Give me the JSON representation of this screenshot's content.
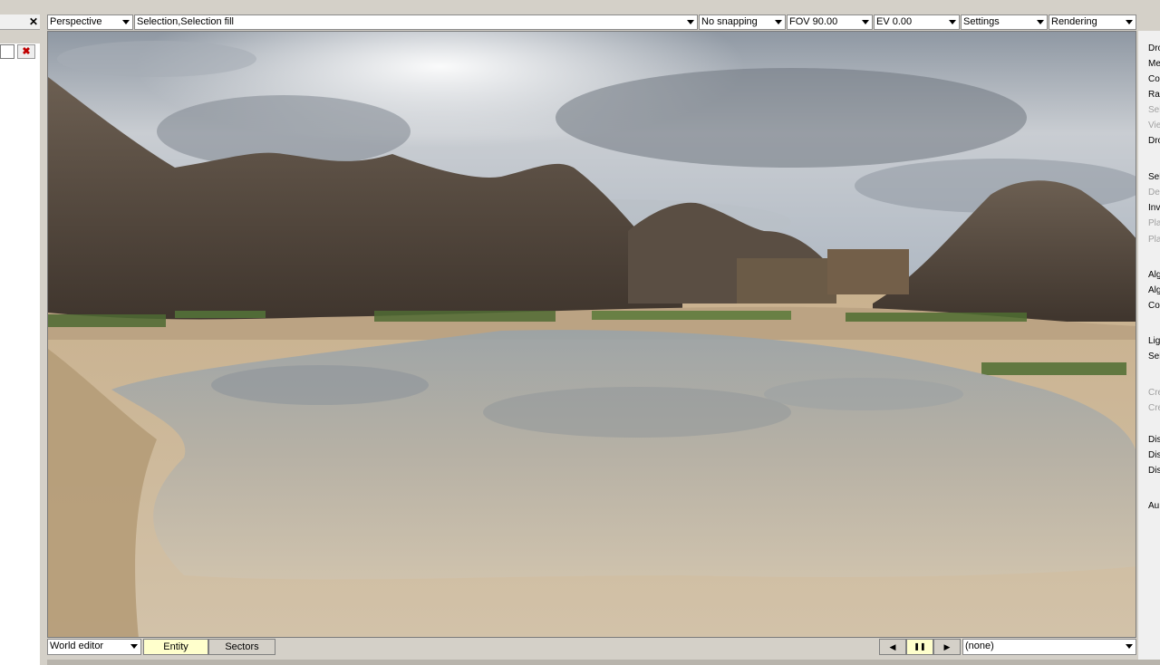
{
  "left_panel": {
    "close_label": "✕",
    "clear_label": "✖"
  },
  "toolbar": {
    "view_mode": "Perspective",
    "selection_mode": "Selection,Selection fill",
    "snapping": "No snapping",
    "fov": "FOV 90.00",
    "ev": "EV  0.00",
    "settings": "Settings",
    "rendering": "Rendering"
  },
  "right_panel": {
    "items": [
      {
        "label": "Dro",
        "enabled": true
      },
      {
        "label": "Me",
        "enabled": true
      },
      {
        "label": "Co",
        "enabled": true
      },
      {
        "label": "Ra",
        "enabled": true
      },
      {
        "label": "Sel",
        "enabled": false
      },
      {
        "label": "Vie",
        "enabled": false
      },
      {
        "label": "Dro",
        "enabled": true
      },
      {
        "label": "Sel",
        "enabled": true
      },
      {
        "label": "De",
        "enabled": false
      },
      {
        "label": "Inv",
        "enabled": true
      },
      {
        "label": "Pla",
        "enabled": false
      },
      {
        "label": "Pla",
        "enabled": false
      },
      {
        "label": "Alg",
        "enabled": true
      },
      {
        "label": "Alg",
        "enabled": true
      },
      {
        "label": "Co",
        "enabled": true
      },
      {
        "label": "Lig",
        "enabled": true
      },
      {
        "label": "Sel",
        "enabled": true
      },
      {
        "label": "Cre",
        "enabled": false
      },
      {
        "label": "Cre",
        "enabled": false
      },
      {
        "label": "Dis",
        "enabled": true
      },
      {
        "label": "Dis",
        "enabled": true
      },
      {
        "label": "Dis",
        "enabled": true
      },
      {
        "label": "Au",
        "enabled": true
      }
    ]
  },
  "bottom": {
    "editor_mode": "World editor",
    "tab_entity": "Entity",
    "tab_sectors": "Sectors",
    "prev_label": "◀",
    "pause_label": "❚❚",
    "next_label": "▶",
    "anim_select": "(none)"
  }
}
